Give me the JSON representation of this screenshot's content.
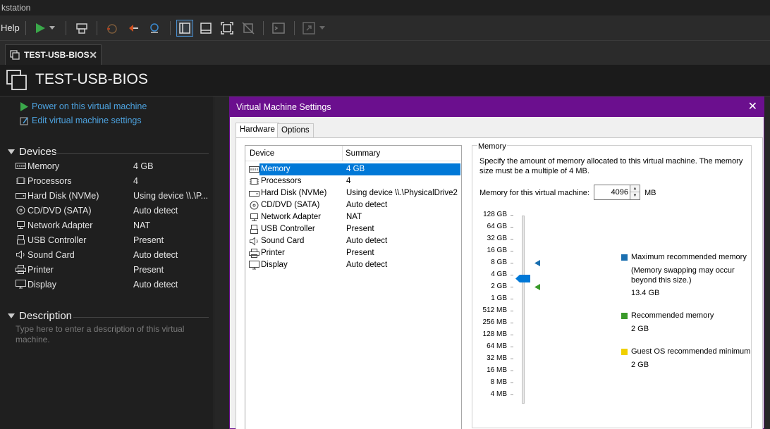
{
  "window": {
    "title": "kstation"
  },
  "toolbar": {
    "help_label": "Help",
    "icons": [
      "play-icon",
      "dropdown-icon",
      "snapshot-icon",
      "revert-icon",
      "take-snapshot-icon",
      "manage-snapshots-icon",
      "library-view-icon",
      "thumbnail-bar-icon",
      "full-screen-icon",
      "unity-icon",
      "console-icon",
      "stretch-icon"
    ]
  },
  "tab": {
    "label": "TEST-USB-BIOS",
    "close": "✕"
  },
  "vm": {
    "title": "TEST-USB-BIOS"
  },
  "actions": {
    "power_on": "Power on this virtual machine",
    "edit_settings": "Edit virtual machine settings"
  },
  "devices_section": {
    "heading": "Devices",
    "items": [
      {
        "name": "Memory",
        "value": "4 GB",
        "icon": "memory-icon"
      },
      {
        "name": "Processors",
        "value": "4",
        "icon": "processor-icon"
      },
      {
        "name": "Hard Disk (NVMe)",
        "value": "Using device \\\\.\\P...",
        "icon": "hard-disk-icon"
      },
      {
        "name": "CD/DVD (SATA)",
        "value": "Auto detect",
        "icon": "cd-dvd-icon"
      },
      {
        "name": "Network Adapter",
        "value": "NAT",
        "icon": "network-adapter-icon"
      },
      {
        "name": "USB Controller",
        "value": "Present",
        "icon": "usb-icon"
      },
      {
        "name": "Sound Card",
        "value": "Auto detect",
        "icon": "sound-card-icon"
      },
      {
        "name": "Printer",
        "value": "Present",
        "icon": "printer-icon"
      },
      {
        "name": "Display",
        "value": "Auto detect",
        "icon": "display-icon"
      }
    ]
  },
  "description_section": {
    "heading": "Description",
    "placeholder": "Type here to enter a description of this virtual machine."
  },
  "dialog": {
    "title": "Virtual Machine Settings",
    "close": "✕",
    "tabs": [
      "Hardware",
      "Options"
    ],
    "device_list": {
      "headers": [
        "Device",
        "Summary"
      ],
      "rows": [
        {
          "name": "Memory",
          "value": "4 GB",
          "selected": true,
          "icon": "memory-icon"
        },
        {
          "name": "Processors",
          "value": "4",
          "icon": "processor-icon"
        },
        {
          "name": "Hard Disk (NVMe)",
          "value": "Using device \\\\.\\PhysicalDrive2",
          "icon": "hard-disk-icon"
        },
        {
          "name": "CD/DVD (SATA)",
          "value": "Auto detect",
          "icon": "cd-dvd-icon"
        },
        {
          "name": "Network Adapter",
          "value": "NAT",
          "icon": "network-adapter-icon"
        },
        {
          "name": "USB Controller",
          "value": "Present",
          "icon": "usb-icon"
        },
        {
          "name": "Sound Card",
          "value": "Auto detect",
          "icon": "sound-card-icon"
        },
        {
          "name": "Printer",
          "value": "Present",
          "icon": "printer-icon"
        },
        {
          "name": "Display",
          "value": "Auto detect",
          "icon": "display-icon"
        }
      ]
    },
    "memory": {
      "group_label": "Memory",
      "description": "Specify the amount of memory allocated to this virtual machine. The memory size must be a multiple of 4 MB.",
      "field_label": "Memory for this virtual machine:",
      "value": "4096",
      "unit": "MB",
      "scale": [
        "128 GB",
        "64 GB",
        "32 GB",
        "16 GB",
        "8 GB",
        "4 GB",
        "2 GB",
        "1 GB",
        "512 MB",
        "256 MB",
        "128 MB",
        "64 MB",
        "32 MB",
        "16 MB",
        "8 MB",
        "4 MB"
      ],
      "current": "4 GB",
      "max_recommended_marker": "16 GB",
      "recommended_marker": "2 GB",
      "legend": [
        {
          "label": "Maximum recommended memory",
          "note": "(Memory swapping may occur beyond this size.)",
          "value": "13.4 GB",
          "color": "#1a6fb0"
        },
        {
          "label": "Recommended memory",
          "value": "2 GB",
          "color": "#3a9a2a"
        },
        {
          "label": "Guest OS recommended minimum",
          "value": "2 GB",
          "color": "#f0d000"
        }
      ]
    }
  }
}
